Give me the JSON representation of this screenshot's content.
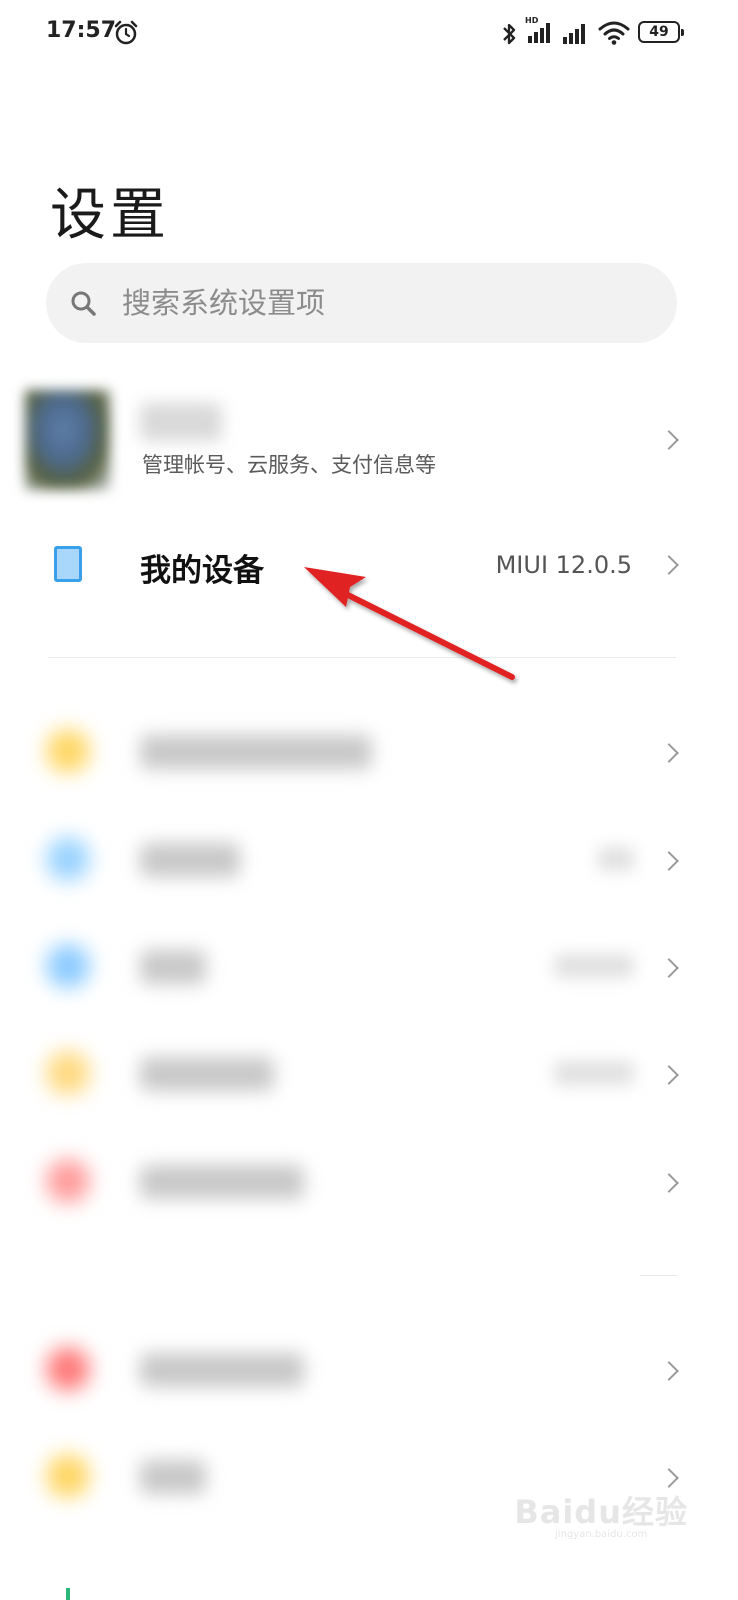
{
  "status_bar": {
    "time": "17:57",
    "icons": [
      "alarm-icon",
      "bluetooth-icon",
      "signal-hd-icon",
      "signal-icon",
      "wifi-icon"
    ],
    "hd_label": "HD",
    "battery": "49"
  },
  "page": {
    "title": "设置"
  },
  "search": {
    "placeholder": "搜索系统设置项",
    "value": ""
  },
  "account": {
    "subtitle": "管理帐号、云服务、支付信息等"
  },
  "my_device": {
    "label": "我的设备",
    "value": "MIUI 12.0.5",
    "icon": "phone-icon",
    "icon_colors": {
      "fill": "#a9d6fb",
      "stroke": "#3aa0ea"
    }
  },
  "annotation": {
    "arrow_color": "#e02020"
  },
  "blurred_items": [
    {
      "dot_color": "#ffd766"
    },
    {
      "dot_color": "#9ad3ff"
    },
    {
      "dot_color": "#8ccbff"
    },
    {
      "dot_color": "#ffd980"
    },
    {
      "dot_color": "#ff9c9c"
    },
    {
      "dot_color": "#ff7a7a"
    },
    {
      "dot_color": "#ffd766"
    }
  ],
  "watermark": {
    "logo": "Baidu经验",
    "url": "jingyan.baidu.com"
  }
}
